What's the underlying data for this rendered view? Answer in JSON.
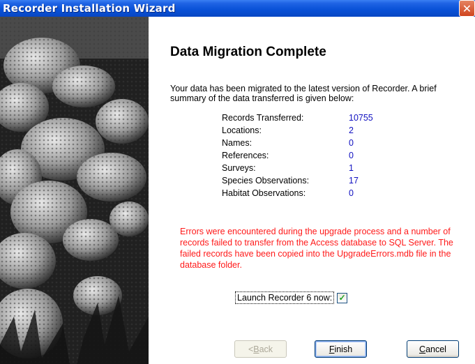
{
  "window": {
    "title": "Recorder Installation Wizard",
    "close_glyph": "✕"
  },
  "page": {
    "heading": "Data Migration Complete",
    "intro": "Your data has been migrated to the latest version of Recorder.  A brief summary of the data transferred is given below:"
  },
  "summary": [
    {
      "label": "Records Transferred:",
      "value": "10755"
    },
    {
      "label": "Locations:",
      "value": "2"
    },
    {
      "label": "Names:",
      "value": "0"
    },
    {
      "label": "References:",
      "value": "0"
    },
    {
      "label": "Surveys:",
      "value": "1"
    },
    {
      "label": "Species Observations:",
      "value": "17"
    },
    {
      "label": "Habitat Observations:",
      "value": "0"
    }
  ],
  "errors_text": "Errors were encountered during the upgrade process and a number of records failed to transfer from the Access database to SQL Server.  The failed records have been copied into the UpgradeErrors.mdb file in the database folder.",
  "launch": {
    "label": "Launch Recorder 6 now:",
    "checked": true,
    "check_glyph": "✓"
  },
  "buttons": {
    "back_first": "< ",
    "back_mnemonic": "B",
    "back_rest": "ack",
    "finish_mnemonic": "F",
    "finish_rest": "inish",
    "cancel_mnemonic": "C",
    "cancel_rest": "ancel"
  },
  "colors": {
    "title_bar": "#0a52d8",
    "value_text": "#1010c0",
    "error_text": "#ff1a1a"
  }
}
